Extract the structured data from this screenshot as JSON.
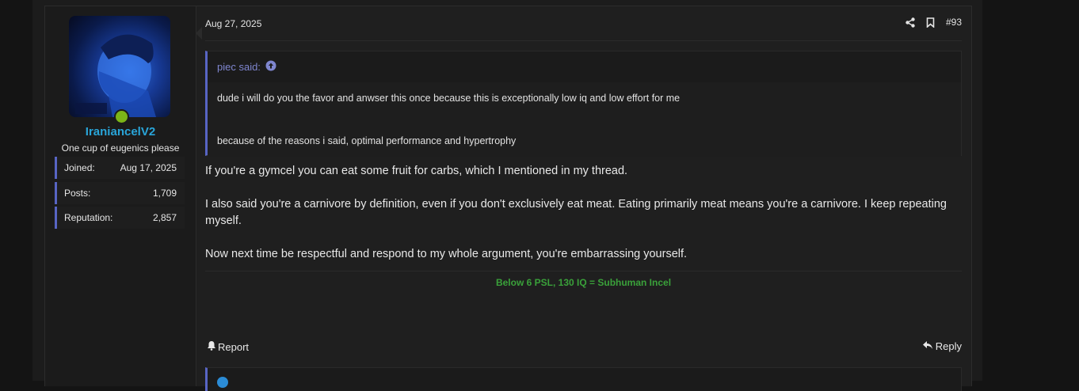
{
  "post": {
    "date": "Aug 27, 2025",
    "number": "#93",
    "icons": [
      "share-icon",
      "bookmark-icon"
    ]
  },
  "user": {
    "name": "IraniancelV2",
    "title": "One cup of eugenics please",
    "online": true,
    "stats": [
      {
        "label": "Joined:",
        "value": "Aug 17, 2025"
      },
      {
        "label": "Posts:",
        "value": "1,709"
      },
      {
        "label": "Reputation:",
        "value": "2,857"
      }
    ]
  },
  "quote": {
    "author": "piec said:",
    "lines": [
      "dude i will do you the favor and anwser this once because this is exceptionally low iq and low effort for me",
      "because of the reasons i said, optimal performance and hypertrophy"
    ]
  },
  "message": {
    "paragraphs": [
      "If you're a gymcel you can eat some fruit for carbs, which I mentioned in my thread.",
      "I also said you're a carnivore by definition, even if you don't exclusively eat meat. Eating primarily meat means you're a carnivore. I keep repeating myself.",
      "Now next time be respectful and respond to my whole argument, you're embarrassing yourself."
    ]
  },
  "signature": "Below 6 PSL, 130 IQ = Subhuman Incel",
  "actions": {
    "report": "Report",
    "reply": "Reply"
  },
  "colors": {
    "username": "#29a5d9",
    "accent": "#5865c4",
    "signature": "#3aa13a",
    "online": "#7cb518"
  }
}
